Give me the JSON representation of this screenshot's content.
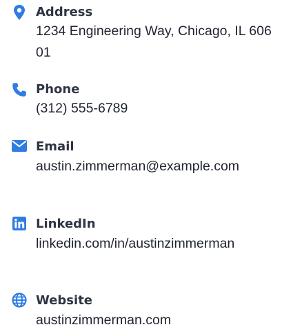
{
  "accent_color": "#2f7de1",
  "contacts": {
    "address": {
      "icon": "map-pin-icon",
      "label": "Address",
      "value": "1234 Engineering Way, Chicago, IL 60601"
    },
    "phone": {
      "icon": "phone-icon",
      "label": "Phone",
      "value": "(312) 555-6789"
    },
    "email": {
      "icon": "envelope-icon",
      "label": "Email",
      "value": "austin.zimmerman@example.com"
    },
    "linkedin": {
      "icon": "linkedin-icon",
      "label": "LinkedIn",
      "value": "linkedin.com/in/austinzimmerman"
    },
    "website": {
      "icon": "globe-icon",
      "label": "Website",
      "value": "austinzimmerman.com"
    }
  }
}
